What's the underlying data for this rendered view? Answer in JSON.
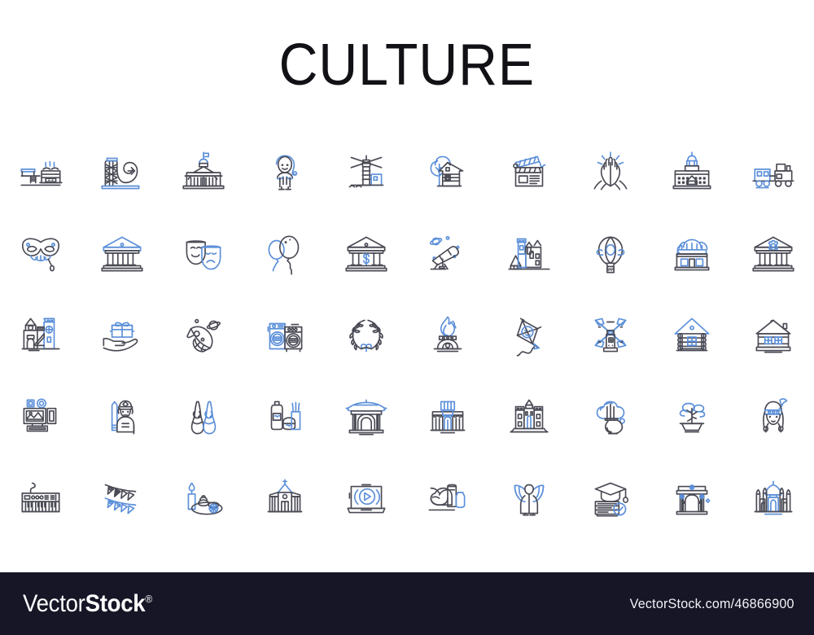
{
  "page": {
    "title": "CULTURE",
    "background_color": "#ffffff",
    "accent_color": "#5b8fd9",
    "line_color": "#4a4a55",
    "grid_columns": 10,
    "grid_rows": 5,
    "icon_count": 50
  },
  "icons": [
    {
      "name": "barbecue-grill-icon",
      "label": "Barbecue grill"
    },
    {
      "name": "roller-coaster-icon",
      "label": "Roller coaster"
    },
    {
      "name": "capitol-building-icon",
      "label": "Capitol building"
    },
    {
      "name": "child-elf-icon",
      "label": "Child in elf hat"
    },
    {
      "name": "lighthouse-icon",
      "label": "Lighthouse"
    },
    {
      "name": "cabin-with-tree-icon",
      "label": "Cabin with tree"
    },
    {
      "name": "clapperboard-icon",
      "label": "Film clapperboard"
    },
    {
      "name": "praying-hands-icon",
      "label": "Praying hands"
    },
    {
      "name": "palace-hotel-icon",
      "label": "Palace hotel"
    },
    {
      "name": "steam-train-icon",
      "label": "Steam train"
    },
    {
      "name": "carnival-mask-icon",
      "label": "Carnival mask"
    },
    {
      "name": "greek-temple-icon",
      "label": "Greek temple"
    },
    {
      "name": "theater-masks-icon",
      "label": "Theater masks"
    },
    {
      "name": "balloons-icon",
      "label": "Balloons"
    },
    {
      "name": "bank-building-icon",
      "label": "Bank building"
    },
    {
      "name": "telescope-icon",
      "label": "Telescope"
    },
    {
      "name": "castle-mansion-icon",
      "label": "Castle mansion"
    },
    {
      "name": "hot-air-balloon-icon",
      "label": "Hot air balloon"
    },
    {
      "name": "rooftop-garden-icon",
      "label": "Rooftop garden"
    },
    {
      "name": "museum-gear-icon",
      "label": "Museum with gear"
    },
    {
      "name": "playground-castle-icon",
      "label": "Playground castle"
    },
    {
      "name": "gift-in-hand-icon",
      "label": "Gift in hand"
    },
    {
      "name": "rocket-planet-icon",
      "label": "Rocket and planet"
    },
    {
      "name": "laundromat-icon",
      "label": "Laundromat machines"
    },
    {
      "name": "laurel-wreath-icon",
      "label": "Laurel wreath"
    },
    {
      "name": "eternal-flame-icon",
      "label": "Eternal flame"
    },
    {
      "name": "kite-icon",
      "label": "Kite"
    },
    {
      "name": "windmill-icon",
      "label": "Windmill"
    },
    {
      "name": "log-cabin-icon",
      "label": "Log cabin"
    },
    {
      "name": "cottage-house-icon",
      "label": "Cottage house"
    },
    {
      "name": "art-gallery-icon",
      "label": "Art gallery frames"
    },
    {
      "name": "knight-warrior-icon",
      "label": "Knight warrior"
    },
    {
      "name": "ballet-shoes-icon",
      "label": "Ballet pointe shoes"
    },
    {
      "name": "spa-cosmetics-icon",
      "label": "Spa cosmetics"
    },
    {
      "name": "pagoda-gate-icon",
      "label": "Pagoda gate"
    },
    {
      "name": "market-stalls-icon",
      "label": "Market stalls"
    },
    {
      "name": "sandcastle-icon",
      "label": "Sandcastle"
    },
    {
      "name": "incense-burner-icon",
      "label": "Incense burner"
    },
    {
      "name": "bonsai-tree-icon",
      "label": "Bonsai tree"
    },
    {
      "name": "native-woman-icon",
      "label": "Native American woman"
    },
    {
      "name": "synthesizer-icon",
      "label": "Synthesizer keyboard"
    },
    {
      "name": "bunting-flags-icon",
      "label": "Bunting flags"
    },
    {
      "name": "spa-candle-stones-icon",
      "label": "Spa candle and stones"
    },
    {
      "name": "chapel-school-icon",
      "label": "Chapel school"
    },
    {
      "name": "laptop-video-icon",
      "label": "Laptop video player"
    },
    {
      "name": "pottery-vases-icon",
      "label": "Pottery vases"
    },
    {
      "name": "angel-icon",
      "label": "Angel"
    },
    {
      "name": "graduation-books-icon",
      "label": "Graduation cap and books"
    },
    {
      "name": "triumphal-arch-icon",
      "label": "Triumphal arch"
    },
    {
      "name": "taj-mahal-icon",
      "label": "Taj Mahal"
    }
  ],
  "footer": {
    "logo_light": "Vector",
    "logo_bold": "Stock",
    "logo_registered": "®",
    "url": "VectorStock.com/46866900",
    "background_color": "#161627"
  }
}
